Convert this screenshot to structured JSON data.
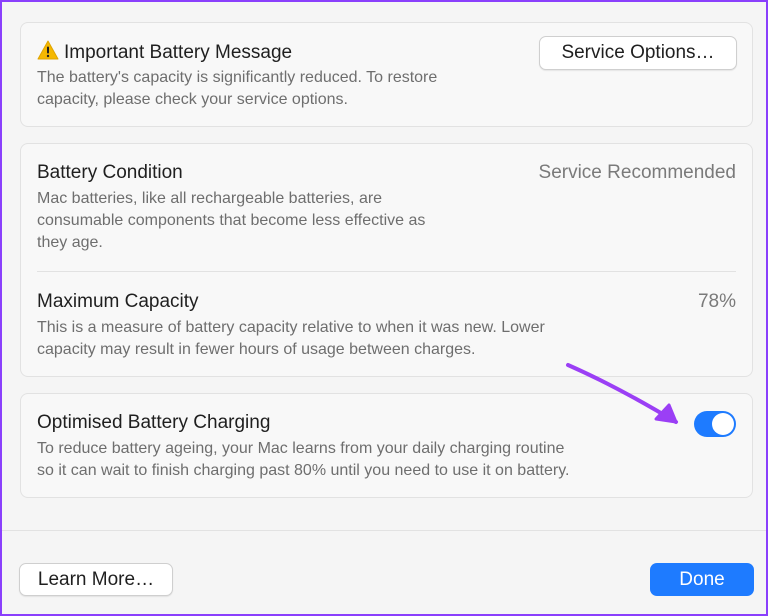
{
  "message_card": {
    "title": "Important Battery Message",
    "description_line1": "The battery's capacity is significantly reduced. To restore",
    "description_line2": "capacity, please check your service options.",
    "service_button_label": "Service Options…",
    "warning_icon": "warning-triangle"
  },
  "battery_condition": {
    "title": "Battery Condition",
    "value": "Service Recommended",
    "description_line1": "Mac batteries, like all rechargeable batteries, are",
    "description_line2": "consumable components that become less effective as",
    "description_line3": "they age."
  },
  "maximum_capacity": {
    "title": "Maximum Capacity",
    "value": "78%",
    "description_line1": "This is a measure of battery capacity relative to when it was new. Lower",
    "description_line2": "capacity may result in fewer hours of usage between charges."
  },
  "optimised_charging": {
    "title": "Optimised Battery Charging",
    "description_line1": "To reduce battery ageing, your Mac learns from your daily charging routine",
    "description_line2": "so it can wait to finish charging past 80% until you need to use it on battery.",
    "enabled": true
  },
  "footer": {
    "learn_more_label": "Learn More…",
    "done_label": "Done"
  },
  "colors": {
    "accent": "#1e7bff",
    "annotation_arrow": "#9b3ff5",
    "warning": "#f5b800"
  }
}
